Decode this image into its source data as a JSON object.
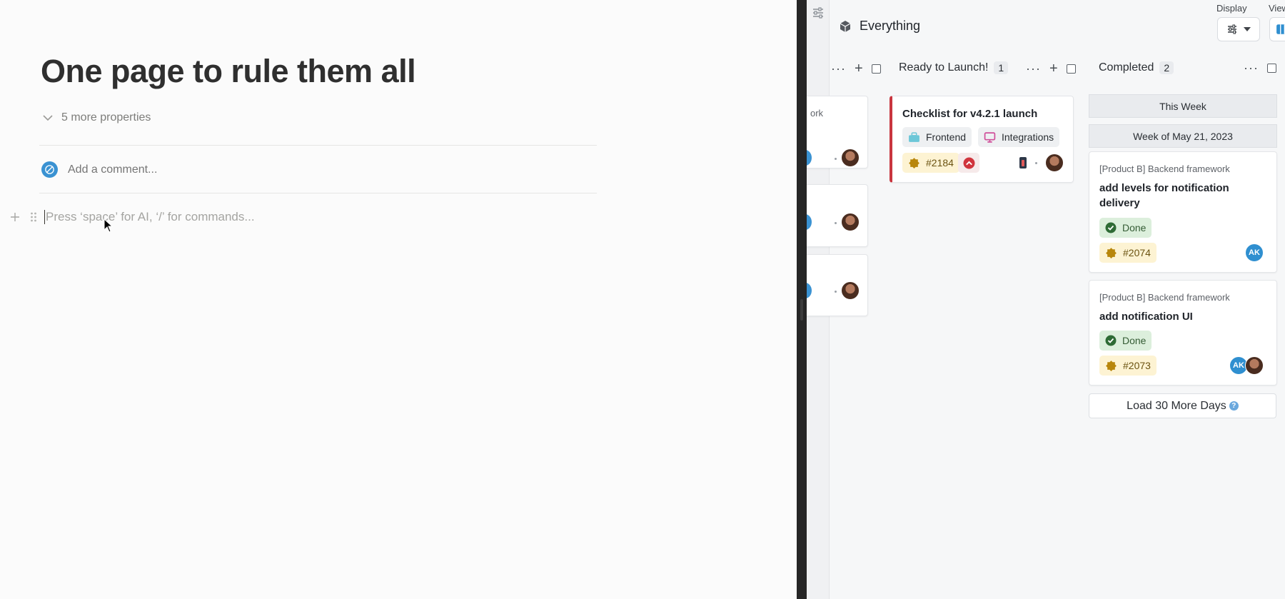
{
  "page": {
    "title": "One page to rule them all",
    "more_properties": "5 more properties",
    "comment_placeholder": "Add a comment...",
    "block_placeholder": "Press ‘space’ for AI, ‘/’ for commands..."
  },
  "board": {
    "title": "Everything",
    "display_label": "Display",
    "view_label": "View",
    "columns": [
      {
        "name": "Ready to Launch!",
        "count": "1"
      },
      {
        "name": "Completed",
        "count": "2"
      }
    ],
    "partial_column": {
      "card_fragment": "ork"
    },
    "ready_card": {
      "title": "Checklist for v4.2.1 launch",
      "tags": [
        "Frontend",
        "Integrations"
      ],
      "issue": "#2184",
      "accent_color": "#c9353e"
    },
    "groups": {
      "this_week": "This Week",
      "week_of": "Week of May 21, 2023"
    },
    "completed_cards": [
      {
        "project": "[Product B] Backend framework",
        "title": "add levels for notification delivery",
        "status": "Done",
        "issue": "#2074",
        "assignee_initials": "AK"
      },
      {
        "project": "[Product B] Backend framework",
        "title": "add notification UI",
        "status": "Done",
        "issue": "#2073",
        "assignee_initials": "AK"
      }
    ],
    "load_more": "Load 30 More Days",
    "help_glyph": "?"
  }
}
